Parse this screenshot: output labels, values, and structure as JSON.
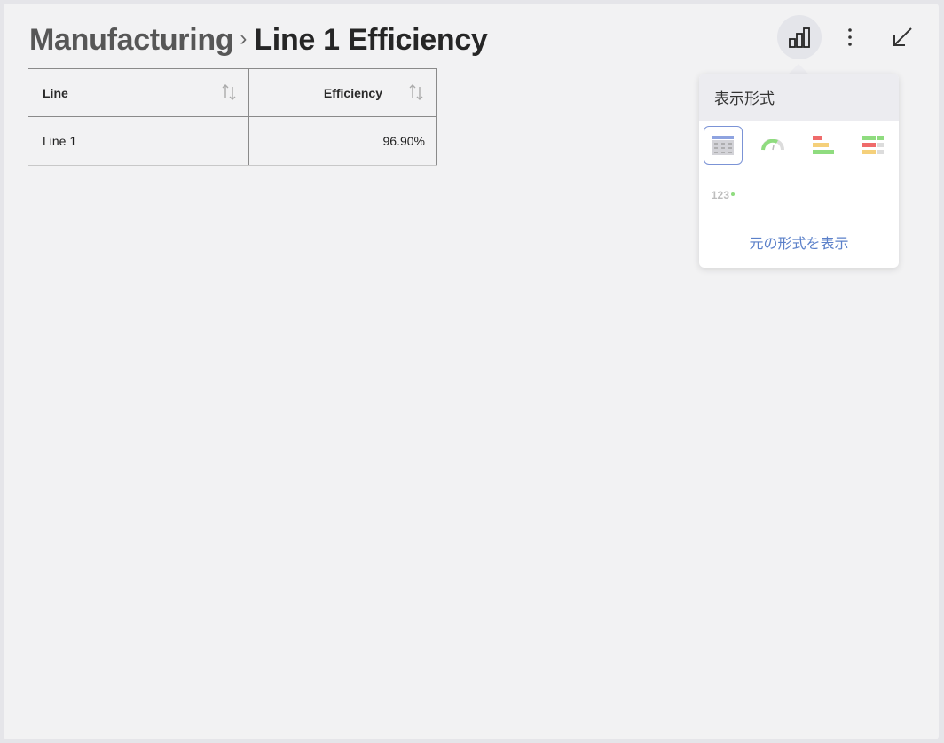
{
  "breadcrumb": {
    "parent": "Manufacturing",
    "separator": "›",
    "current": "Line 1 Efficiency"
  },
  "toolbar": {
    "viz_icon": "bar-chart-icon",
    "more_icon": "more-vertical-icon",
    "collapse_icon": "collapse-arrow-icon"
  },
  "table": {
    "columns": [
      "Line",
      "Efficiency"
    ],
    "rows": [
      {
        "line": "Line 1",
        "efficiency": "96.90%"
      }
    ]
  },
  "popover": {
    "title": "表示形式",
    "options": [
      {
        "icon": "grid-icon",
        "selected": true
      },
      {
        "icon": "gauge-icon",
        "selected": false
      },
      {
        "icon": "horizontal-bar-icon",
        "selected": false
      },
      {
        "icon": "heatmap-grid-icon",
        "selected": false
      },
      {
        "icon": "kpi-text-icon",
        "label": "123",
        "selected": false
      }
    ],
    "show_original": "元の形式を表示"
  },
  "colors": {
    "accent": "#5b80c9",
    "selected_border": "#7b93d6",
    "red": "#ef6b6b",
    "yellow": "#f5d07a",
    "green": "#8fdc7f"
  }
}
